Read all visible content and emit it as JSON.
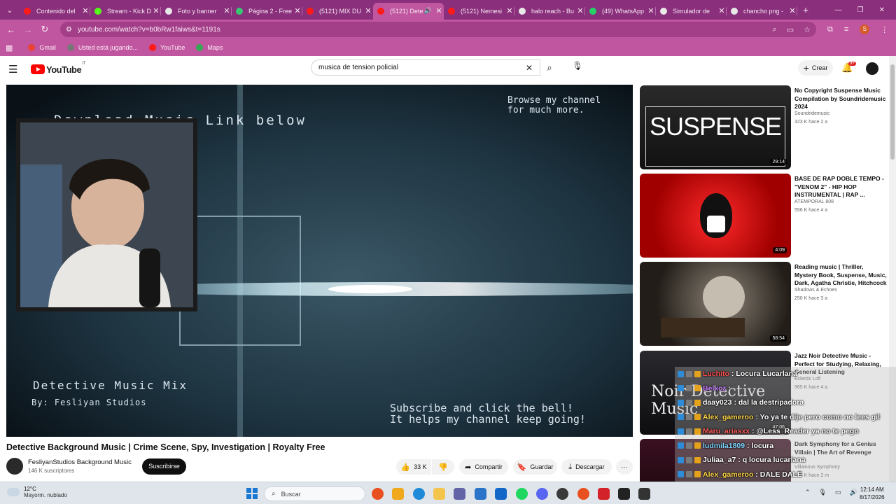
{
  "tabs": [
    {
      "title": "Contenido del",
      "color": "#ff1a1a"
    },
    {
      "title": "Stream - Kick D",
      "color": "#53fc18"
    },
    {
      "title": "Foto y banner",
      "color": "#e8e8e8"
    },
    {
      "title": "Página 2 - Free",
      "color": "#37c871"
    },
    {
      "title": "(5121) MIX DU",
      "color": "#ff1a1a"
    },
    {
      "title": "(5121) Dete",
      "color": "#ff1a1a"
    },
    {
      "title": "(5121) Nemesi",
      "color": "#ff1a1a"
    },
    {
      "title": "halo reach - Bu",
      "color": "#e8e8e8"
    },
    {
      "title": "(49) WhatsApp",
      "color": "#25d366"
    },
    {
      "title": "Simulador de",
      "color": "#e8e8e8"
    },
    {
      "title": "chancho png -",
      "color": "#e8e8e8"
    }
  ],
  "address": {
    "url": "youtube.com/watch?v=b0bRw1faiws&t=1191s"
  },
  "bookmarks": [
    {
      "label": "Gmail",
      "color": "#ea4335"
    },
    {
      "label": "Usted está jugando...",
      "color": "#777777"
    },
    {
      "label": "YouTube",
      "color": "#ff1a1a"
    },
    {
      "label": "Maps",
      "color": "#34a853"
    }
  ],
  "yt": {
    "logo": "YouTube",
    "cc": "IT",
    "search_query": "musica de tension policial",
    "create": "Crear",
    "notif_badge": "9+"
  },
  "video": {
    "overlay_download": "Download Music Link below",
    "overlay_browse1": "Browse my channel",
    "overlay_browse2": "for much more.",
    "overlay_mix": "Detective Music Mix",
    "overlay_by": "By: Fesliyan Studios",
    "overlay_sub1": "Subscribe and click the bell!",
    "overlay_sub2": "It helps my channel keep going!",
    "title": "Detective Background Music | Crime Scene, Spy, Investigation | Royalty Free",
    "channel": "FesliyanStudios Background Music",
    "subscribers": "146 K suscriptores",
    "subscribe": "Suscribirse",
    "likes": "33 K",
    "share": "Compartir",
    "save": "Guardar",
    "download": "Descargar"
  },
  "recommendations": [
    {
      "title": "No Copyright Suspense Music Compilation by Soundridemusic 2024",
      "channel": "Soundridemusic",
      "meta": "323 K   hace 2 a",
      "duration": "29:14",
      "thumb_text": "SUSPENSE"
    },
    {
      "title": "BASE DE RAP DOBLE TEMPO - \"VENOM 2\" - HIP HOP INSTRUMENTAL | RAP ...",
      "channel": "ATEMPORAL 808",
      "meta": "556 K   hace 4 a",
      "duration": "4:09"
    },
    {
      "title": "Reading music | Thriller, Mystery Book, Suspense, Music, Dark, Agatha Christie, Hitchcock",
      "channel": "Shadows & Echoes",
      "meta": "250 K   hace 3 a",
      "duration": "58:54"
    },
    {
      "title": "Jazz Noir Detective Music - Perfect for Studying, Relaxing, General Listening",
      "channel": "Eclectic Lofi",
      "meta": "965 K   hace 4 a",
      "duration": "47:06",
      "thumb_text": "Noir Detective Music"
    },
    {
      "title": "Dark Symphony for a Genius Villain | The Art of Revenge",
      "channel": "Villainous Symphony",
      "meta": "145 K   hace 2 m",
      "duration": ""
    }
  ],
  "chat": [
    {
      "user": "Luchito",
      "msg": ": Locura Lucarlana",
      "color": "#ff4d4d"
    },
    {
      "user": "Belxcz",
      "msg": ": ",
      "color": "#c77dff"
    },
    {
      "user": "daay023",
      "msg": ": dal la destripadora",
      "color": "#ffffff"
    },
    {
      "user": "Alex_gameroo",
      "msg": ": Yo ya te dije pero como no lees gil",
      "color": "#ffd54a"
    },
    {
      "user": "Maru_ariasxx",
      "msg": ": @Less_Reader ya no te pego",
      "color": "#ff5a5a"
    },
    {
      "user": "ludmila1809",
      "msg": ": locura",
      "color": "#7fd6ff"
    },
    {
      "user": "Juliaa_a7",
      "msg": ": q locura lucarlana",
      "color": "#ffffff"
    },
    {
      "user": "Alex_gameroo",
      "msg": ": DALE DALE",
      "color": "#ffd54a"
    }
  ],
  "taskbar": {
    "temp": "12°C",
    "weather": "Mayorm. nublado",
    "search": "Buscar",
    "time": "12:14 AM",
    "date": "8/17/2026"
  }
}
